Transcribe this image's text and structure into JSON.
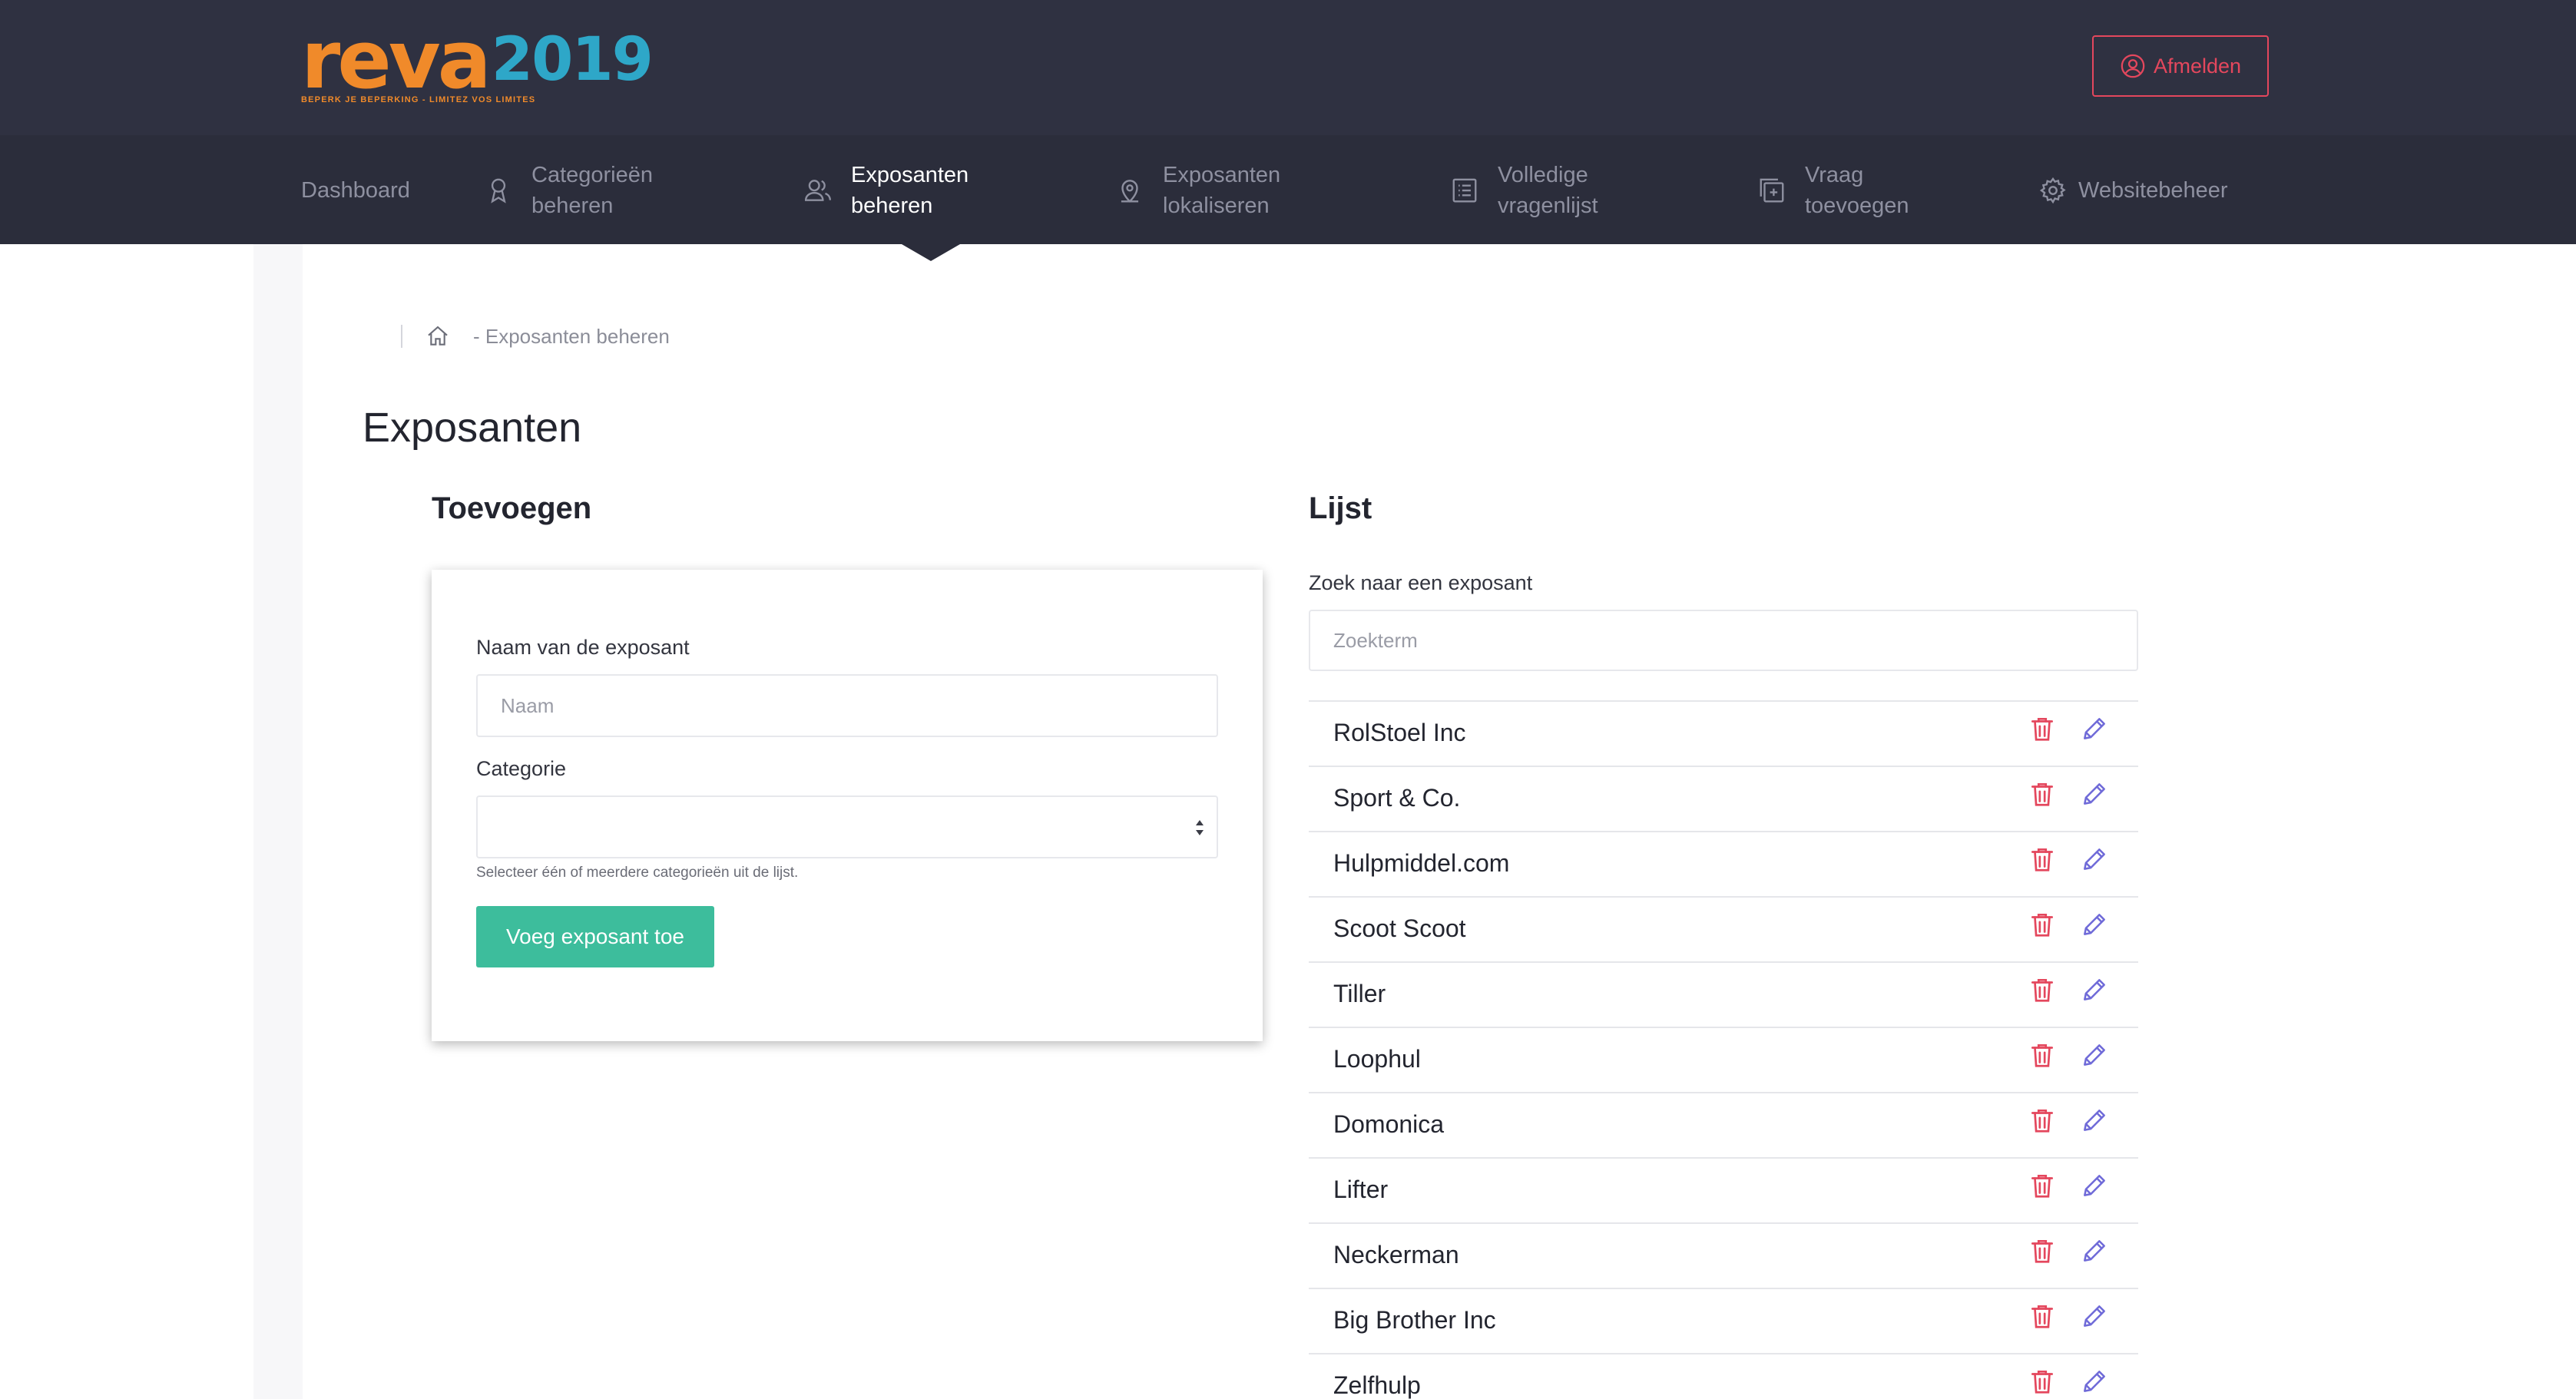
{
  "brand": {
    "logo_text": "reva",
    "logo_year": "2019",
    "tagline": "BEPERK JE BEPERKING - LIMITEZ VOS LIMITES"
  },
  "header": {
    "logout_label": "Afmelden"
  },
  "nav": {
    "items": [
      {
        "label": "Dashboard",
        "icon": "dashboard",
        "active": false
      },
      {
        "label": "Categorieën\nbeheren",
        "icon": "ribbon-icon",
        "active": false
      },
      {
        "label": "Exposanten\nbeheren",
        "icon": "users-icon",
        "active": true
      },
      {
        "label": "Exposanten\nlokaliseren",
        "icon": "map-pin-icon",
        "active": false
      },
      {
        "label": "Volledige\nvragenlijst",
        "icon": "list-icon",
        "active": false
      },
      {
        "label": "Vraag\ntoevoegen",
        "icon": "add-box-icon",
        "active": false
      },
      {
        "label": "Websitebeheer",
        "icon": "gear-icon",
        "active": false
      }
    ]
  },
  "breadcrumb": {
    "current": "- Exposanten beheren"
  },
  "page": {
    "title": "Exposanten"
  },
  "add_form": {
    "title": "Toevoegen",
    "name_label": "Naam van de exposant",
    "name_placeholder": "Naam",
    "name_value": "",
    "category_label": "Categorie",
    "category_value": "",
    "category_hint": "Selecteer één of meerdere categorieën uit de lijst.",
    "submit_label": "Voeg exposant toe"
  },
  "list": {
    "title": "Lijst",
    "search_label": "Zoek naar een exposant",
    "search_placeholder": "Zoekterm",
    "search_value": "",
    "items": [
      "RolStoel Inc",
      "Sport & Co.",
      "Hulpmiddel.com",
      "Scoot Scoot",
      "Tiller",
      "Loophul",
      "Domonica",
      "Lifter",
      "Neckerman",
      "Big Brother Inc",
      "Zelfhulp"
    ]
  },
  "colors": {
    "header_bg": "#2f3141",
    "nav_bg": "#2b2d3b",
    "accent_orange": "#f08a2a",
    "accent_blue": "#2ea7c8",
    "danger_red": "#e4475d",
    "primary_green": "#3dbd9c",
    "edit_purple": "#6f6ad8"
  }
}
